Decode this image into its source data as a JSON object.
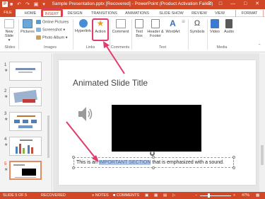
{
  "titlebar": {
    "app_icon": "P",
    "qat": "■ ↶ ↷ ▣ ▾",
    "title": "Sample Presentation.pptx [Recovered] - PowerPoint (Product Activation Failed)",
    "window_controls": "? □ — □ ✕"
  },
  "tabs": [
    "FILE",
    "HOME",
    "INSERT",
    "DESIGN",
    "TRANSITIONS",
    "ANIMATIONS",
    "SLIDE SHOW",
    "REVIEW",
    "VIEW",
    "FORMAT"
  ],
  "active_tab": "INSERT",
  "ribbon": {
    "new_slide": "New Slide",
    "new_slide_arrow": "▾",
    "pictures": "Pictures",
    "online_pictures": "Online Pictures",
    "screenshot": "Screenshot ▾",
    "photo_album": "Photo Album ▾",
    "hyperlink": "Hyperlink",
    "action": "Action",
    "comment": "Comment",
    "text_box": "Text Box",
    "header_footer": "Header & Footer",
    "wordart": "WordArt",
    "symbols": "Symbols",
    "video": "Video",
    "audio": "Audio",
    "groups": {
      "slides": "Slides",
      "images": "Images",
      "links": "Links",
      "comments": "Comments",
      "text": "Text",
      "media": "Media"
    }
  },
  "thumbnails": [
    {
      "num": "1",
      "star": "★"
    },
    {
      "num": "2",
      "star": "★"
    },
    {
      "num": "3",
      "star": "★"
    },
    {
      "num": "4",
      "star": "★"
    },
    {
      "num": "5",
      "star": "★"
    }
  ],
  "slide": {
    "title": "Animated Slide Title",
    "text_before": "This is an ",
    "text_highlight": "IMPORTANT SECTION",
    "text_after": " that is emphasized with a sound."
  },
  "statusbar": {
    "slide_of": "SLIDE 5 OF 5",
    "recovered": "RECOVERED",
    "notes": "≡ NOTES",
    "comments": "■ COMMENTS",
    "zoom_minus": "−",
    "zoom_plus": "+",
    "zoom": "47%"
  },
  "colors": {
    "accent": "#d24726",
    "annotation": "#e23a6b",
    "highlight": "#b4c7e3"
  }
}
